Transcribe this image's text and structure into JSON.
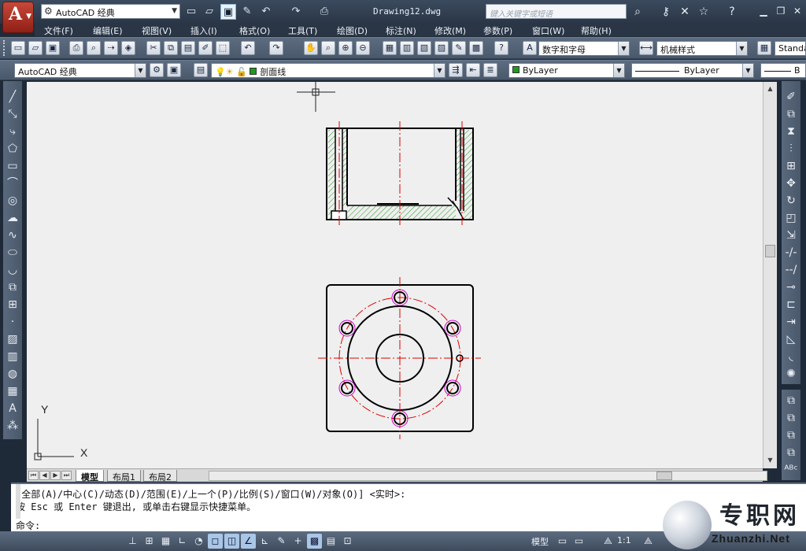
{
  "titlebar": {
    "workspace": "AutoCAD 经典",
    "document_title": "Drawing12.dwg",
    "search_placeholder": "键入关键字或短语"
  },
  "menu": [
    "文件(F)",
    "编辑(E)",
    "视图(V)",
    "插入(I)",
    "格式(O)",
    "工具(T)",
    "绘图(D)",
    "标注(N)",
    "修改(M)",
    "参数(P)",
    "窗口(W)",
    "帮助(H)"
  ],
  "toolbar": {
    "text_style": "数字和字母",
    "dim_style": "机械样式",
    "table_style": "Standa",
    "workspace_combo": "AutoCAD 经典",
    "layer": "剖面线",
    "color": "ByLayer",
    "linetype": "ByLayer",
    "lineweight": "B"
  },
  "layout_tabs": [
    "模型",
    "布局1",
    "布局2"
  ],
  "active_tab": "模型",
  "command": {
    "line1": "[全部(A)/中心(C)/动态(D)/范围(E)/上一个(P)/比例(S)/窗口(W)/对象(O)] <实时>:",
    "line2": "按 Esc 或 Enter 键退出, 或单击右键显示快捷菜单。",
    "prompt": "命令:"
  },
  "status": {
    "model": "模型",
    "annotation_scale": "1:1"
  },
  "ucs": {
    "x_label": "X",
    "y_label": "Y"
  },
  "watermark": {
    "cn": "专职网",
    "en": "Zhuanzhi.Net"
  },
  "colors": {
    "canvas": "#efefef",
    "outline": "#000000",
    "centerline": "#e00000",
    "hatch": "#1f9a1f",
    "bolt_circle": "#cc00cc",
    "ui_dark": "#2a3646"
  }
}
